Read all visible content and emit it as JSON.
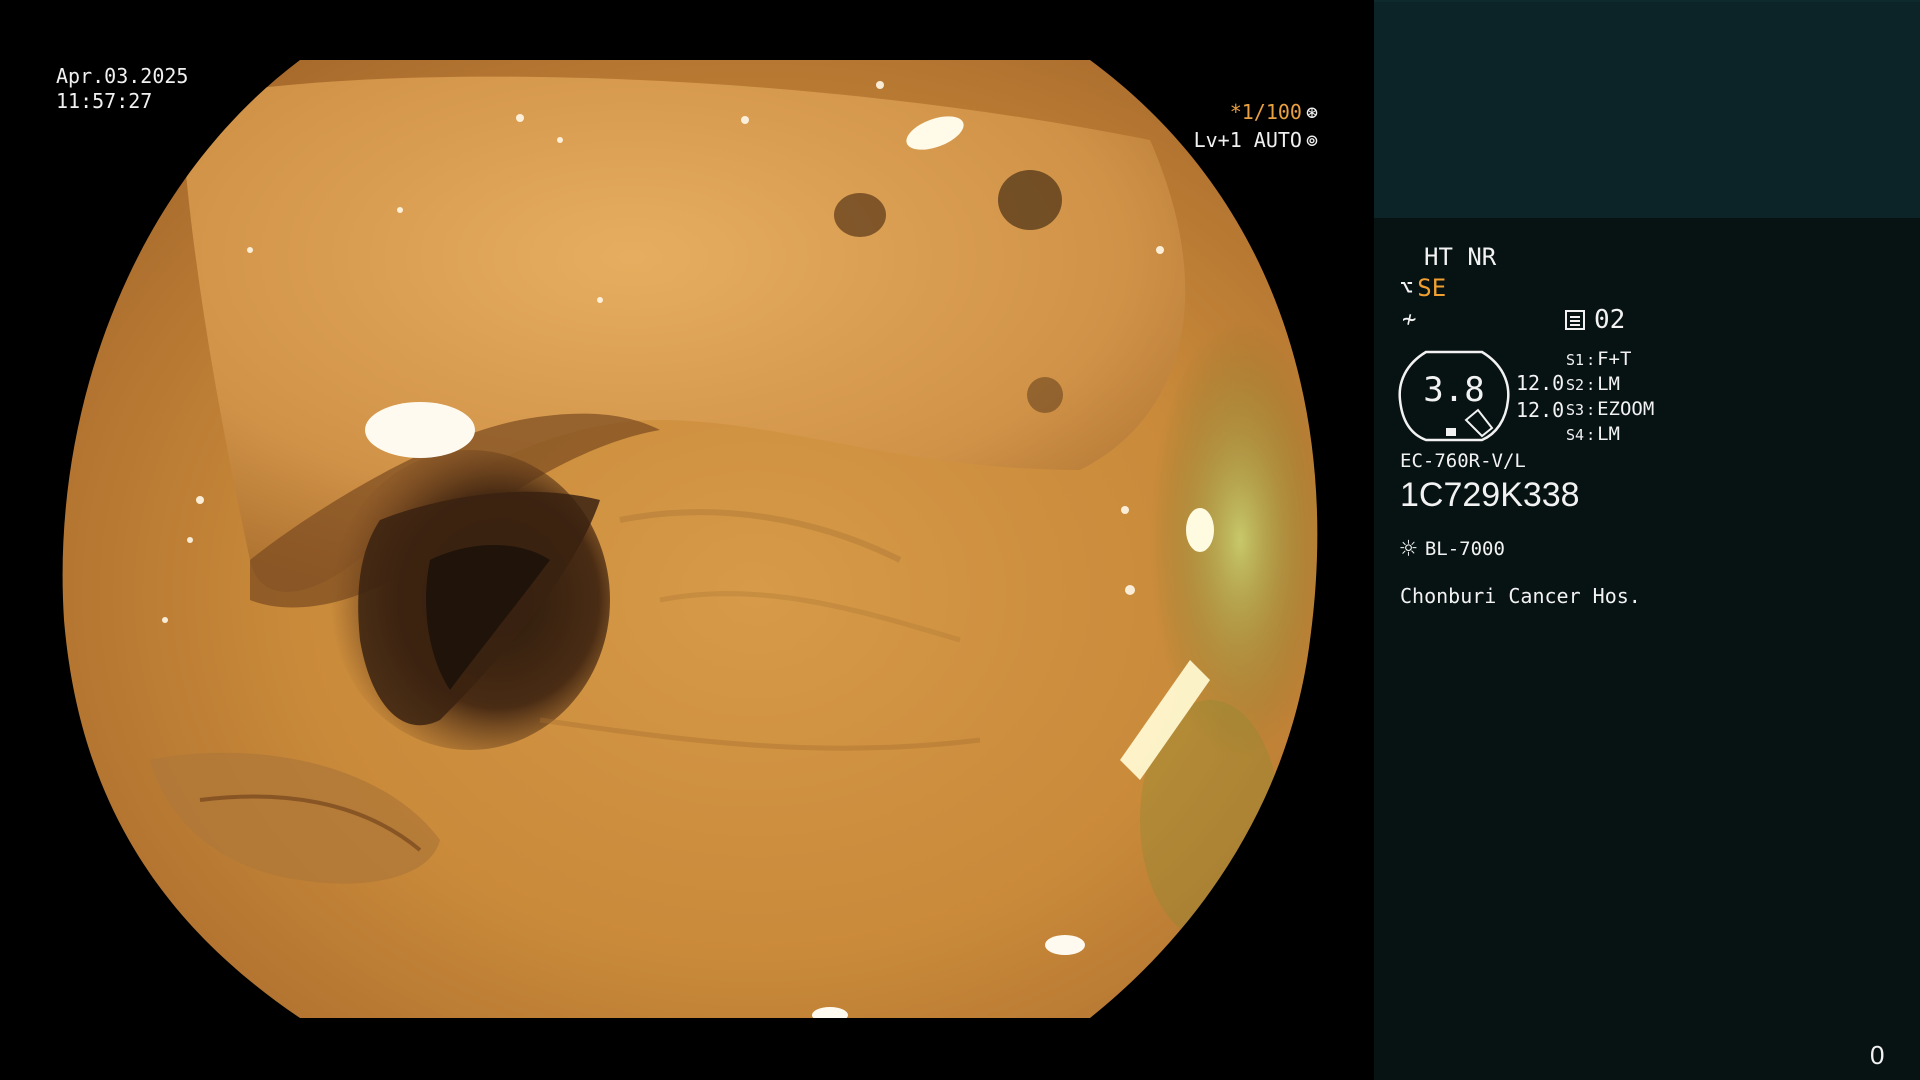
{
  "overlay": {
    "date": "Apr.03.2025",
    "time": "11:57:27",
    "shutter": "*1/100",
    "shutter_icon": "aperture-icon",
    "iris": "Lv+1 AUTO",
    "iris_icon": "iris-icon"
  },
  "panel": {
    "enhance_mode": "HT NR",
    "se_label": "SE",
    "se_icon": "structure-enhance-icon",
    "filter_icon": "filter-icon",
    "memo_icon": "memory-icon",
    "memo_value": "02",
    "zoom_value": "3.8",
    "gain_top": "12.0",
    "gain_bottom": "12.0",
    "switches": [
      {
        "key": "S1",
        "value": "F+T"
      },
      {
        "key": "S2",
        "value": "LM"
      },
      {
        "key": "S3",
        "value": "EZOOM"
      },
      {
        "key": "S4",
        "value": "LM"
      }
    ],
    "scope_model": "EC-760R-V/L",
    "scope_serial": "1C729K338",
    "light_icon": "sun-icon",
    "light_source": "BL-7000",
    "hospital": "Chonburi Cancer Hos.",
    "counter": "0"
  },
  "colors": {
    "panel_bg": "#071213",
    "thumb_bg": "#0c2327",
    "accent_orange": "#f0a030",
    "tissue_main": "#c98a3a",
    "tissue_dark": "#5a3418"
  }
}
